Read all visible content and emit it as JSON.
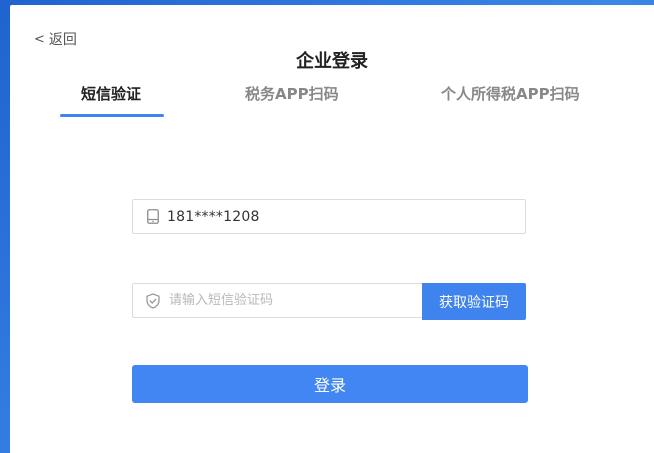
{
  "header": {
    "back_label": "返回",
    "back_chevron": "<",
    "title": "企业登录"
  },
  "tabs": [
    {
      "label": "短信验证",
      "active": true
    },
    {
      "label": "税务APP扫码",
      "active": false
    },
    {
      "label": "个人所得税APP扫码",
      "active": false
    }
  ],
  "form": {
    "phone_value": "181****1208",
    "phone_icon": "mobile-phone-icon",
    "code_placeholder": "请输入短信验证码",
    "code_icon": "shield-check-icon",
    "get_code_label": "获取验证码",
    "login_label": "登录"
  },
  "colors": {
    "accent": "#3f84ee",
    "login_button": "#4186f2",
    "desktop_background": "#2a6fd6"
  }
}
